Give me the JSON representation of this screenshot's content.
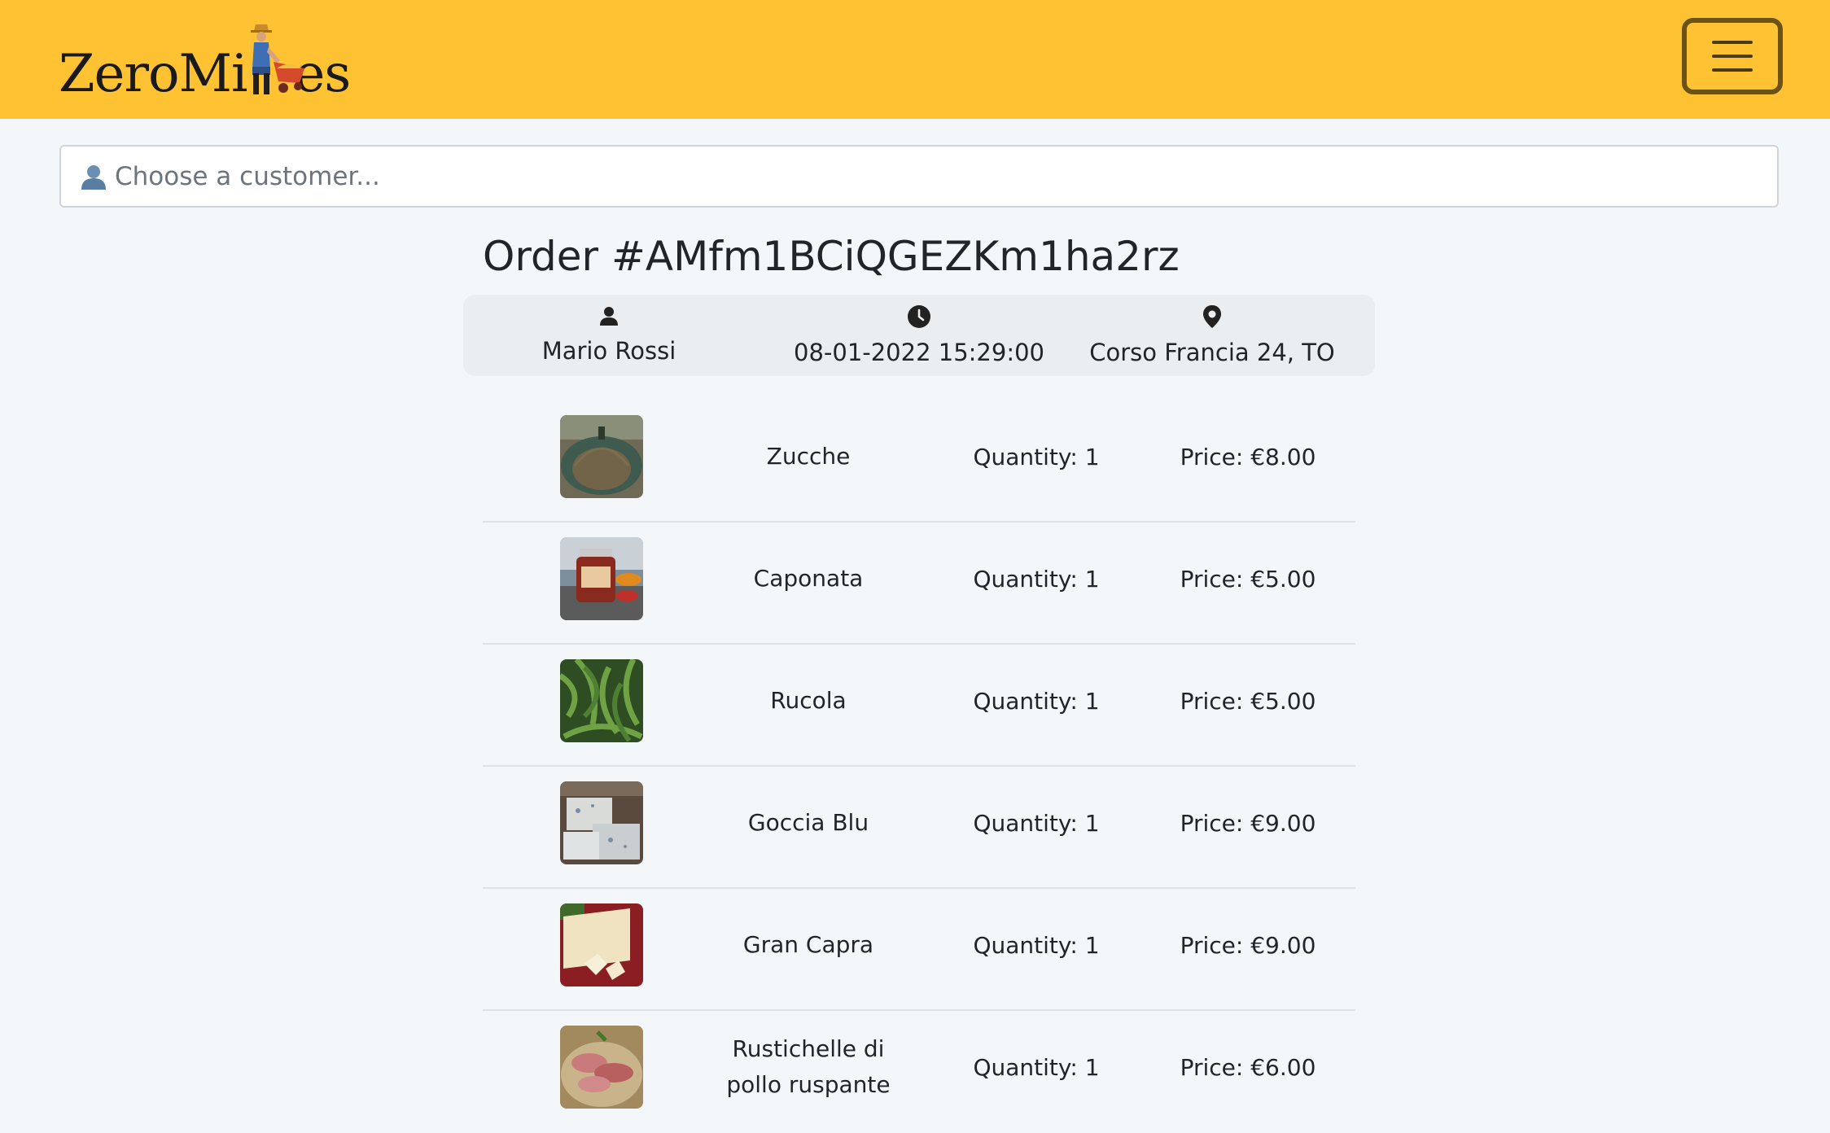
{
  "brand": {
    "logo_text_left": "ZeroMi",
    "logo_text_right": "es",
    "logo_icon": "farmer-with-wheelbarrow-icon"
  },
  "navbar": {
    "menu_icon": "hamburger-menu-icon"
  },
  "customer_select": {
    "placeholder": "Choose a customer...",
    "icon": "user-silhouette-icon"
  },
  "order": {
    "title": "Order #AMfm1BCiQGEZKm1ha2rz",
    "customer": "Mario Rossi",
    "datetime": "08-01-2022 15:29:00",
    "address": "Corso Francia 24, TO",
    "icons": {
      "customer": "person-icon",
      "datetime": "clock-icon",
      "address": "map-pin-icon"
    },
    "items": [
      {
        "name": "Zucche",
        "quantity": "Quantity: 1",
        "price": "Price: €8.00"
      },
      {
        "name": "Caponata",
        "quantity": "Quantity: 1",
        "price": "Price: €5.00"
      },
      {
        "name": "Rucola",
        "quantity": "Quantity: 1",
        "price": "Price: €5.00"
      },
      {
        "name": "Goccia Blu",
        "quantity": "Quantity: 1",
        "price": "Price: €9.00"
      },
      {
        "name": "Gran Capra",
        "quantity": "Quantity: 1",
        "price": "Price: €9.00"
      },
      {
        "name": "Rustichelle di pollo ruspante",
        "quantity": "Quantity: 1",
        "price": "Price: €6.00"
      }
    ]
  },
  "colors": {
    "navbar": "#ffc233",
    "menu_border": "#6b5318",
    "background": "#f4f7fa",
    "info_card": "#ebeef1"
  }
}
